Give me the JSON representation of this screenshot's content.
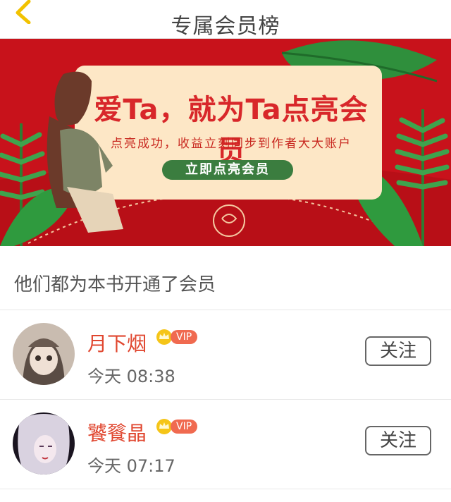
{
  "header": {
    "title": "专属会员榜",
    "back_icon": "chevron-left-icon"
  },
  "banner": {
    "headline": "爱Ta，就为Ta点亮会员",
    "subtitle": "点亮成功，收益立刻同步到作者大大账户",
    "cta_label": "立即点亮会员",
    "colors": {
      "background": "#c8121b",
      "card": "#fde7c6",
      "leaf": "#2e8b3a",
      "cta": "#3b7d3f"
    }
  },
  "section": {
    "heading": "他们都为本书开通了会员"
  },
  "members": [
    {
      "name": "月下烟",
      "badge": "VIP",
      "time": "今天 08:38",
      "follow_label": "关注"
    },
    {
      "name": "饕餮晶",
      "badge": "VIP",
      "time": "今天 07:17",
      "follow_label": "关注"
    }
  ],
  "colors": {
    "accent": "#e0462f",
    "vip": "#f06a50"
  }
}
